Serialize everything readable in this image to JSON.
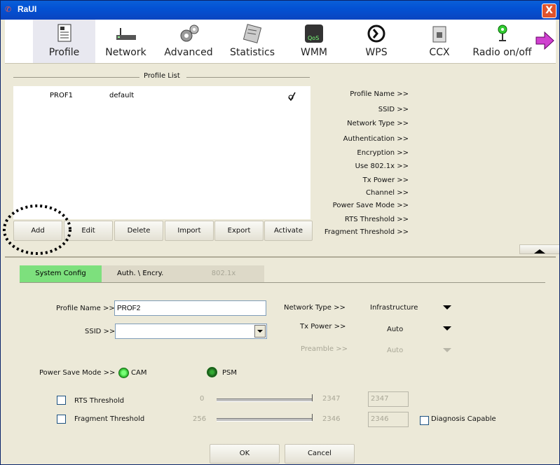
{
  "window": {
    "title": "RaUI",
    "close_label": "X"
  },
  "toolbar": {
    "items": [
      {
        "label": "Profile"
      },
      {
        "label": "Network"
      },
      {
        "label": "Advanced"
      },
      {
        "label": "Statistics"
      },
      {
        "label": "WMM"
      },
      {
        "label": "WPS"
      },
      {
        "label": "CCX"
      },
      {
        "label": "Radio on/off"
      }
    ]
  },
  "profile_list": {
    "legend": "Profile List",
    "rows": [
      {
        "name": "PROF1",
        "ssid": "default"
      }
    ]
  },
  "profile_buttons": {
    "add": "Add",
    "edit": "Edit",
    "delete": "Delete",
    "import": "Import",
    "export": "Export",
    "activate": "Activate"
  },
  "profile_info": {
    "labels": [
      "Profile Name >>",
      "SSID >>",
      "Network Type >>",
      "Authentication >>",
      "Encryption >>",
      "Use 802.1x >>",
      "Tx Power >>",
      "Channel >>",
      "Power Save Mode >>",
      "RTS Threshold >>",
      "Fragment Threshold >>"
    ]
  },
  "tabs": {
    "system_config": "System Config",
    "auth": "Auth. \\ Encry.",
    "dot1x": "802.1x"
  },
  "config": {
    "profile_name_label": "Profile Name >>",
    "profile_name_value": "PROF2",
    "ssid_label": "SSID >>",
    "ssid_value": "",
    "network_type_label": "Network Type >>",
    "network_type_value": "Infrastructure",
    "tx_power_label": "Tx Power >>",
    "tx_power_value": "Auto",
    "preamble_label": "Preamble >>",
    "preamble_value": "Auto",
    "power_save_label": "Power Save Mode >>",
    "cam_label": "CAM",
    "psm_label": "PSM",
    "rts_label": "RTS Threshold",
    "rts_min": "0",
    "rts_max": "2347",
    "rts_value": "2347",
    "frag_label": "Fragment Threshold",
    "frag_min": "256",
    "frag_max": "2346",
    "frag_value": "2346",
    "diag_label": "Diagnosis Capable",
    "ok_label": "OK",
    "cancel_label": "Cancel"
  },
  "colors": {
    "active_tab": "#7de07d",
    "title_bar": "#0a56d8"
  }
}
